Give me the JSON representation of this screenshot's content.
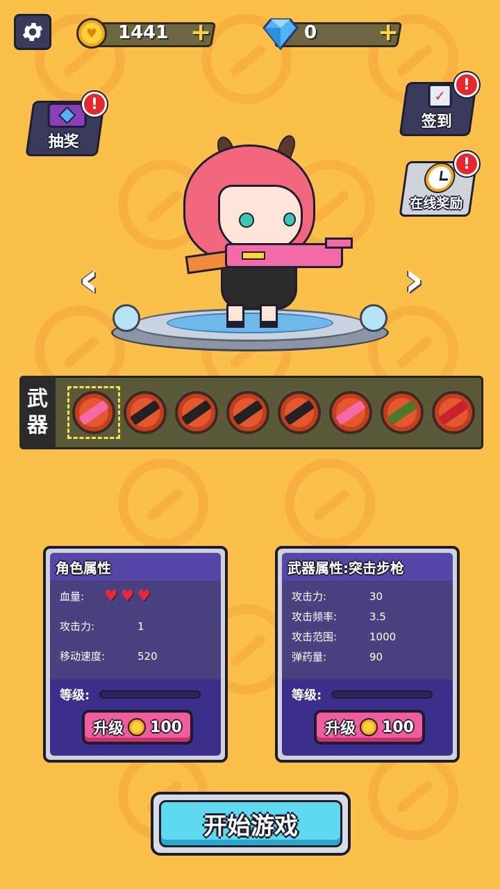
{
  "top_bar": {
    "coins": "1441",
    "gems": "0"
  },
  "side_buttons": {
    "lottery_label": "抽奖",
    "checkin_label": "签到",
    "online_reward_label": "在线奖励",
    "alert_mark": "!"
  },
  "weapons": {
    "label_line1": "武",
    "label_line2": "器",
    "slots": [
      "rocket-launcher",
      "revolver",
      "smg",
      "shotgun",
      "assault-rifle",
      "water-gun",
      "sniper-rifle",
      "red-cannon"
    ]
  },
  "character_panel": {
    "title": "角色属性",
    "hp_label": "血量:",
    "hp_hearts": 3,
    "attack_label": "攻击力:",
    "attack_value": "1",
    "speed_label": "移动速度:",
    "speed_value": "520",
    "level_label": "等级:",
    "upgrade_label": "升级",
    "upgrade_cost": "100"
  },
  "weapon_panel": {
    "title": "武器属性:突击步枪",
    "attack_label": "攻击力:",
    "attack_value": "30",
    "rate_label": "攻击频率:",
    "rate_value": "3.5",
    "range_label": "攻击范围:",
    "range_value": "1000",
    "ammo_label": "弹药量:",
    "ammo_value": "90",
    "level_label": "等级:",
    "upgrade_label": "升级",
    "upgrade_cost": "100"
  },
  "start_button": {
    "label": "开始游戏"
  },
  "colors": {
    "background": "#fbc04a",
    "panel": "#3a2f8a",
    "upgrade": "#f05d9c",
    "start": "#5ed9f0"
  }
}
